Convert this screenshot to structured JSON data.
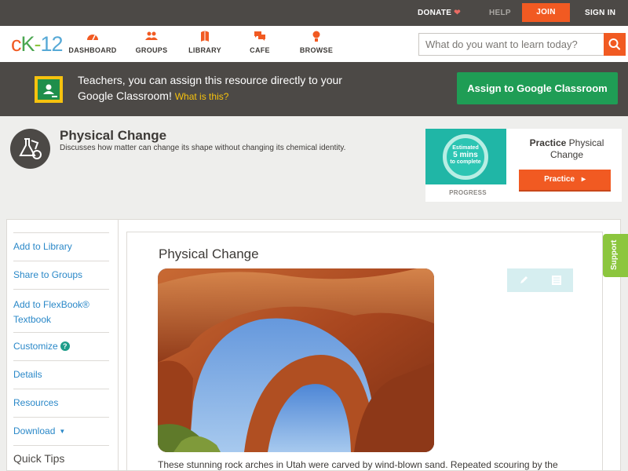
{
  "topbar": {
    "donate_label": "DONATE",
    "help_label": "HELP",
    "join_label": "JOIN",
    "signin_label": "SIGN IN"
  },
  "brand": {
    "logo_c": "c",
    "logo_k": "K",
    "logo_dash": "-",
    "logo_12": "12"
  },
  "nav": {
    "items": [
      {
        "label": "DASHBOARD",
        "icon": "dashboard-icon"
      },
      {
        "label": "GROUPS",
        "icon": "groups-icon"
      },
      {
        "label": "LIBRARY",
        "icon": "library-icon"
      },
      {
        "label": "CAFE",
        "icon": "cafe-icon"
      },
      {
        "label": "BROWSE",
        "icon": "browse-icon"
      }
    ]
  },
  "search": {
    "placeholder": "What do you want to learn today?",
    "value": ""
  },
  "banner": {
    "text": "Teachers, you can assign this resource directly to your Google Classroom!",
    "what_link": "What is this?",
    "assign_label": "Assign to Google Classroom"
  },
  "concept": {
    "title": "Physical Change",
    "description": "Discusses how matter can change its shape without changing its chemical identity."
  },
  "practice": {
    "estimated_line1": "Estimated",
    "estimated_line2": "5 mins",
    "estimated_line3": "to complete",
    "progress_label": "PROGRESS",
    "practice_bold": "Practice",
    "practice_rest": "Physical Change",
    "button_label": "Practice"
  },
  "sidebar": {
    "items": [
      {
        "label": "Add to Library"
      },
      {
        "label": "Share to Groups"
      },
      {
        "label": "Add to FlexBook® Textbook"
      },
      {
        "label": "Customize"
      },
      {
        "label": "Details"
      },
      {
        "label": "Resources"
      },
      {
        "label": "Download"
      }
    ],
    "customize_help": "?",
    "quick_tips": "Quick Tips"
  },
  "lesson": {
    "title": "Physical Change",
    "paragraph": "These stunning rock arches in Utah were carved by wind-blown sand. Repeated scouring by the"
  },
  "support": {
    "label": "Support"
  },
  "colors": {
    "accent": "#f15a22",
    "dark": "#4c4946",
    "link": "#2a88c8",
    "classroom_green": "#1f9d55",
    "support_green": "#8cc63e"
  }
}
